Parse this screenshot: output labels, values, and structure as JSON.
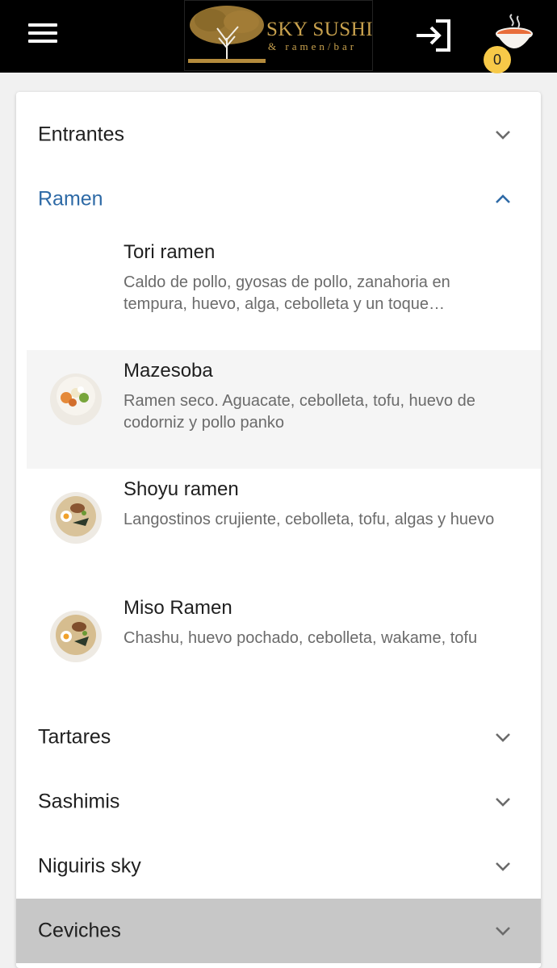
{
  "header": {
    "logo_title": "SKY SUSHI",
    "logo_subtitle": "& ramen/bar",
    "cart_count": "0"
  },
  "categories": [
    {
      "label": "Entrantes"
    },
    {
      "label": "Ramen",
      "expanded": true
    },
    {
      "label": "Tartares"
    },
    {
      "label": "Sashimis"
    },
    {
      "label": "Niguiris sky"
    },
    {
      "label": "Ceviches"
    }
  ],
  "ramen_items": [
    {
      "name": "Tori ramen",
      "description": "Caldo de pollo, gyosas de pollo, zanahoria en tempura, huevo, alga, cebolleta y un toque…",
      "has_image": false
    },
    {
      "name": "Mazesoba",
      "description": "Ramen seco. Aguacate, cebolleta, tofu, huevo de codorniz y pollo panko",
      "has_image": true
    },
    {
      "name": "Shoyu ramen",
      "description": "Langostinos crujiente, cebolleta, tofu, algas y huevo",
      "has_image": true
    },
    {
      "name": "Miso Ramen",
      "description": "Chashu, huevo pochado, cebolleta, wakame, tofu",
      "has_image": true
    }
  ],
  "colors": {
    "accent": "#2e6aa6",
    "header_bg": "#000000",
    "badge": "#f7c948",
    "logo_gold": "#c9a24e"
  },
  "icons": [
    "menu-icon",
    "login-icon",
    "ramen-bowl-cart-icon",
    "chevron-down-icon",
    "chevron-up-icon"
  ]
}
